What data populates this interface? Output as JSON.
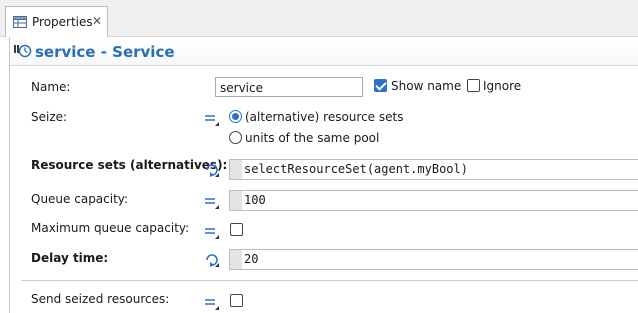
{
  "tab": {
    "label": "Properties",
    "icon": "properties-table-icon",
    "close_glyph": "✕"
  },
  "header": {
    "title": "service - Service",
    "icon": "service-block-icon"
  },
  "fields": {
    "name": {
      "label": "Name:",
      "value": "service",
      "show_name_label": "Show name",
      "show_name_checked": true,
      "ignore_label": "Ignore",
      "ignore_checked": false
    },
    "seize": {
      "label": "Seize:",
      "options": [
        "(alternative) resource sets",
        "units of the same pool"
      ],
      "selected": "(alternative) resource sets"
    },
    "resource_sets": {
      "label": "Resource sets (alternatives):",
      "value": "selectResourceSet(agent.myBool)"
    },
    "queue_capacity": {
      "label": "Queue capacity:",
      "value": "100"
    },
    "max_queue_capacity": {
      "label": "Maximum queue capacity:",
      "checked": false
    },
    "delay_time": {
      "label": "Delay time:",
      "value": "20"
    },
    "send_seized": {
      "label": "Send seized resources:",
      "checked": false
    }
  },
  "colors": {
    "accent": "#2b6fcf",
    "header_title": "#2a6fb3"
  }
}
